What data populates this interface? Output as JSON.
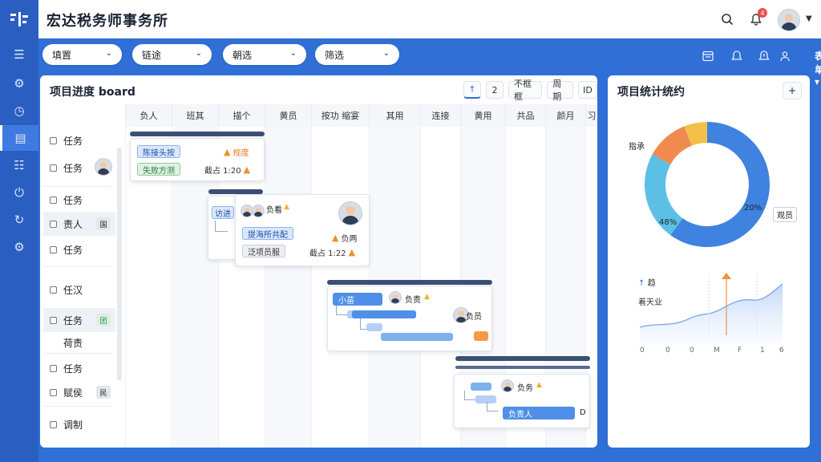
{
  "app": {
    "title": "宏达税务师事务所"
  },
  "header": {
    "notification_count": "4",
    "user_menu_label": "表单"
  },
  "filters": [
    {
      "label": "填置"
    },
    {
      "label": "链途"
    },
    {
      "label": "朝选"
    },
    {
      "label": "筛选"
    }
  ],
  "board": {
    "title": "项目进度 board",
    "tools": {
      "up": "↑",
      "page": "2",
      "t1": "不框框",
      "t2": "周期",
      "t3": "ID"
    },
    "columns": [
      "负人",
      "班其",
      "描个",
      "黄员",
      "按功  缩宴",
      "其用",
      "连接",
      "黄用",
      "共品",
      "颜月",
      "习"
    ]
  },
  "tasks": [
    {
      "label": "任务",
      "tag": ""
    },
    {
      "label": "任务",
      "tag": ""
    },
    {
      "label": "任务",
      "tag": ""
    },
    {
      "label": "责人",
      "tag": "国"
    },
    {
      "label": "任务",
      "tag": ""
    },
    {
      "label": "任汉",
      "tag": ""
    },
    {
      "label": "任务",
      "tag": "团"
    },
    {
      "label": "荷责",
      "tag": ""
    },
    {
      "label": "任务",
      "tag": ""
    },
    {
      "label": "赋侯",
      "tag": "民"
    },
    {
      "label": "调制",
      "tag": ""
    }
  ],
  "cards": {
    "c1": {
      "tag1": "陈接头按",
      "tag2": "失败方测",
      "warn1": "规度",
      "warn2": "截占 1:20"
    },
    "c2": {
      "tag1": "访进",
      "name": "负看",
      "tag2": "提海所共配",
      "tag3": "泛项员服",
      "warn1": "负两",
      "warn2": "截占 1:22"
    },
    "c3": {
      "tag1": "小苗",
      "name1": "负责",
      "name2": "负员"
    },
    "c4": {
      "name": "负务",
      "tag1": "负责人",
      "end": "D"
    }
  },
  "stats": {
    "title": "项目统计统约",
    "add_label": "+",
    "donut": {
      "labels": {
        "top_left": "指承",
        "right": "20%",
        "right_box": "观员",
        "left": "48%"
      }
    },
    "line": {
      "legend1": "趋",
      "legend2": "着天业",
      "ticks": [
        "0",
        "0",
        "0",
        "M",
        "F",
        "1",
        "6"
      ]
    }
  },
  "chart_data": {
    "type": "pie",
    "series": [
      {
        "values": [
          60,
          23,
          11,
          6
        ]
      }
    ],
    "labels": [
      "",
      "48%",
      "",
      ""
    ],
    "colors": [
      "#3f82e0",
      "#5cc0e6",
      "#f18a4e",
      "#f3c14a"
    ]
  }
}
